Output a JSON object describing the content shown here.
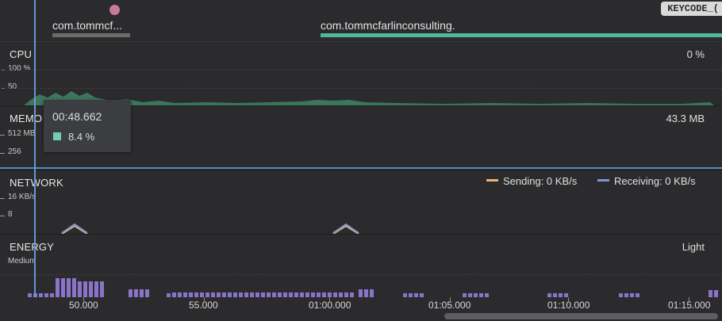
{
  "timeline": {
    "activity_short": "com.tommcf...",
    "activity_long": "com.tommcfarlinconsulting.",
    "keycode_badge": "KEYCODE_("
  },
  "cpu": {
    "title": "CPU",
    "value": "0 %",
    "ticks": [
      "100 %",
      "50"
    ],
    "series_color": "#3d7a5f"
  },
  "memory": {
    "title": "MEMO",
    "value": "43.3 MB",
    "ticks": [
      "512 MB",
      "256"
    ],
    "line_color": "#4a8fc4"
  },
  "tooltip": {
    "time": "00:48.662",
    "value": "8.4 %",
    "swatch_color": "#6fd0b0"
  },
  "network": {
    "title": "NETWORK",
    "ticks": [
      "16 KB/s",
      "8"
    ],
    "legend_sending": "Sending: 0 KB/s",
    "legend_receiving": "Receiving: 0 KB/s",
    "sending_color": "#e9b477",
    "receiving_color": "#7d93d6"
  },
  "energy": {
    "title": "ENERGY",
    "value": "Light",
    "ticks": [
      "Medium"
    ],
    "bar_color": "#8a74c9"
  },
  "time_axis": {
    "labels": [
      "50.000",
      "55.000",
      "01:00.000",
      "01:05.000",
      "01:10.000",
      "01:15.000"
    ]
  },
  "colors": {
    "activity_gray": "#6b6b6b",
    "activity_teal": "#4fb99a",
    "cursor": "#6b95d8"
  }
}
